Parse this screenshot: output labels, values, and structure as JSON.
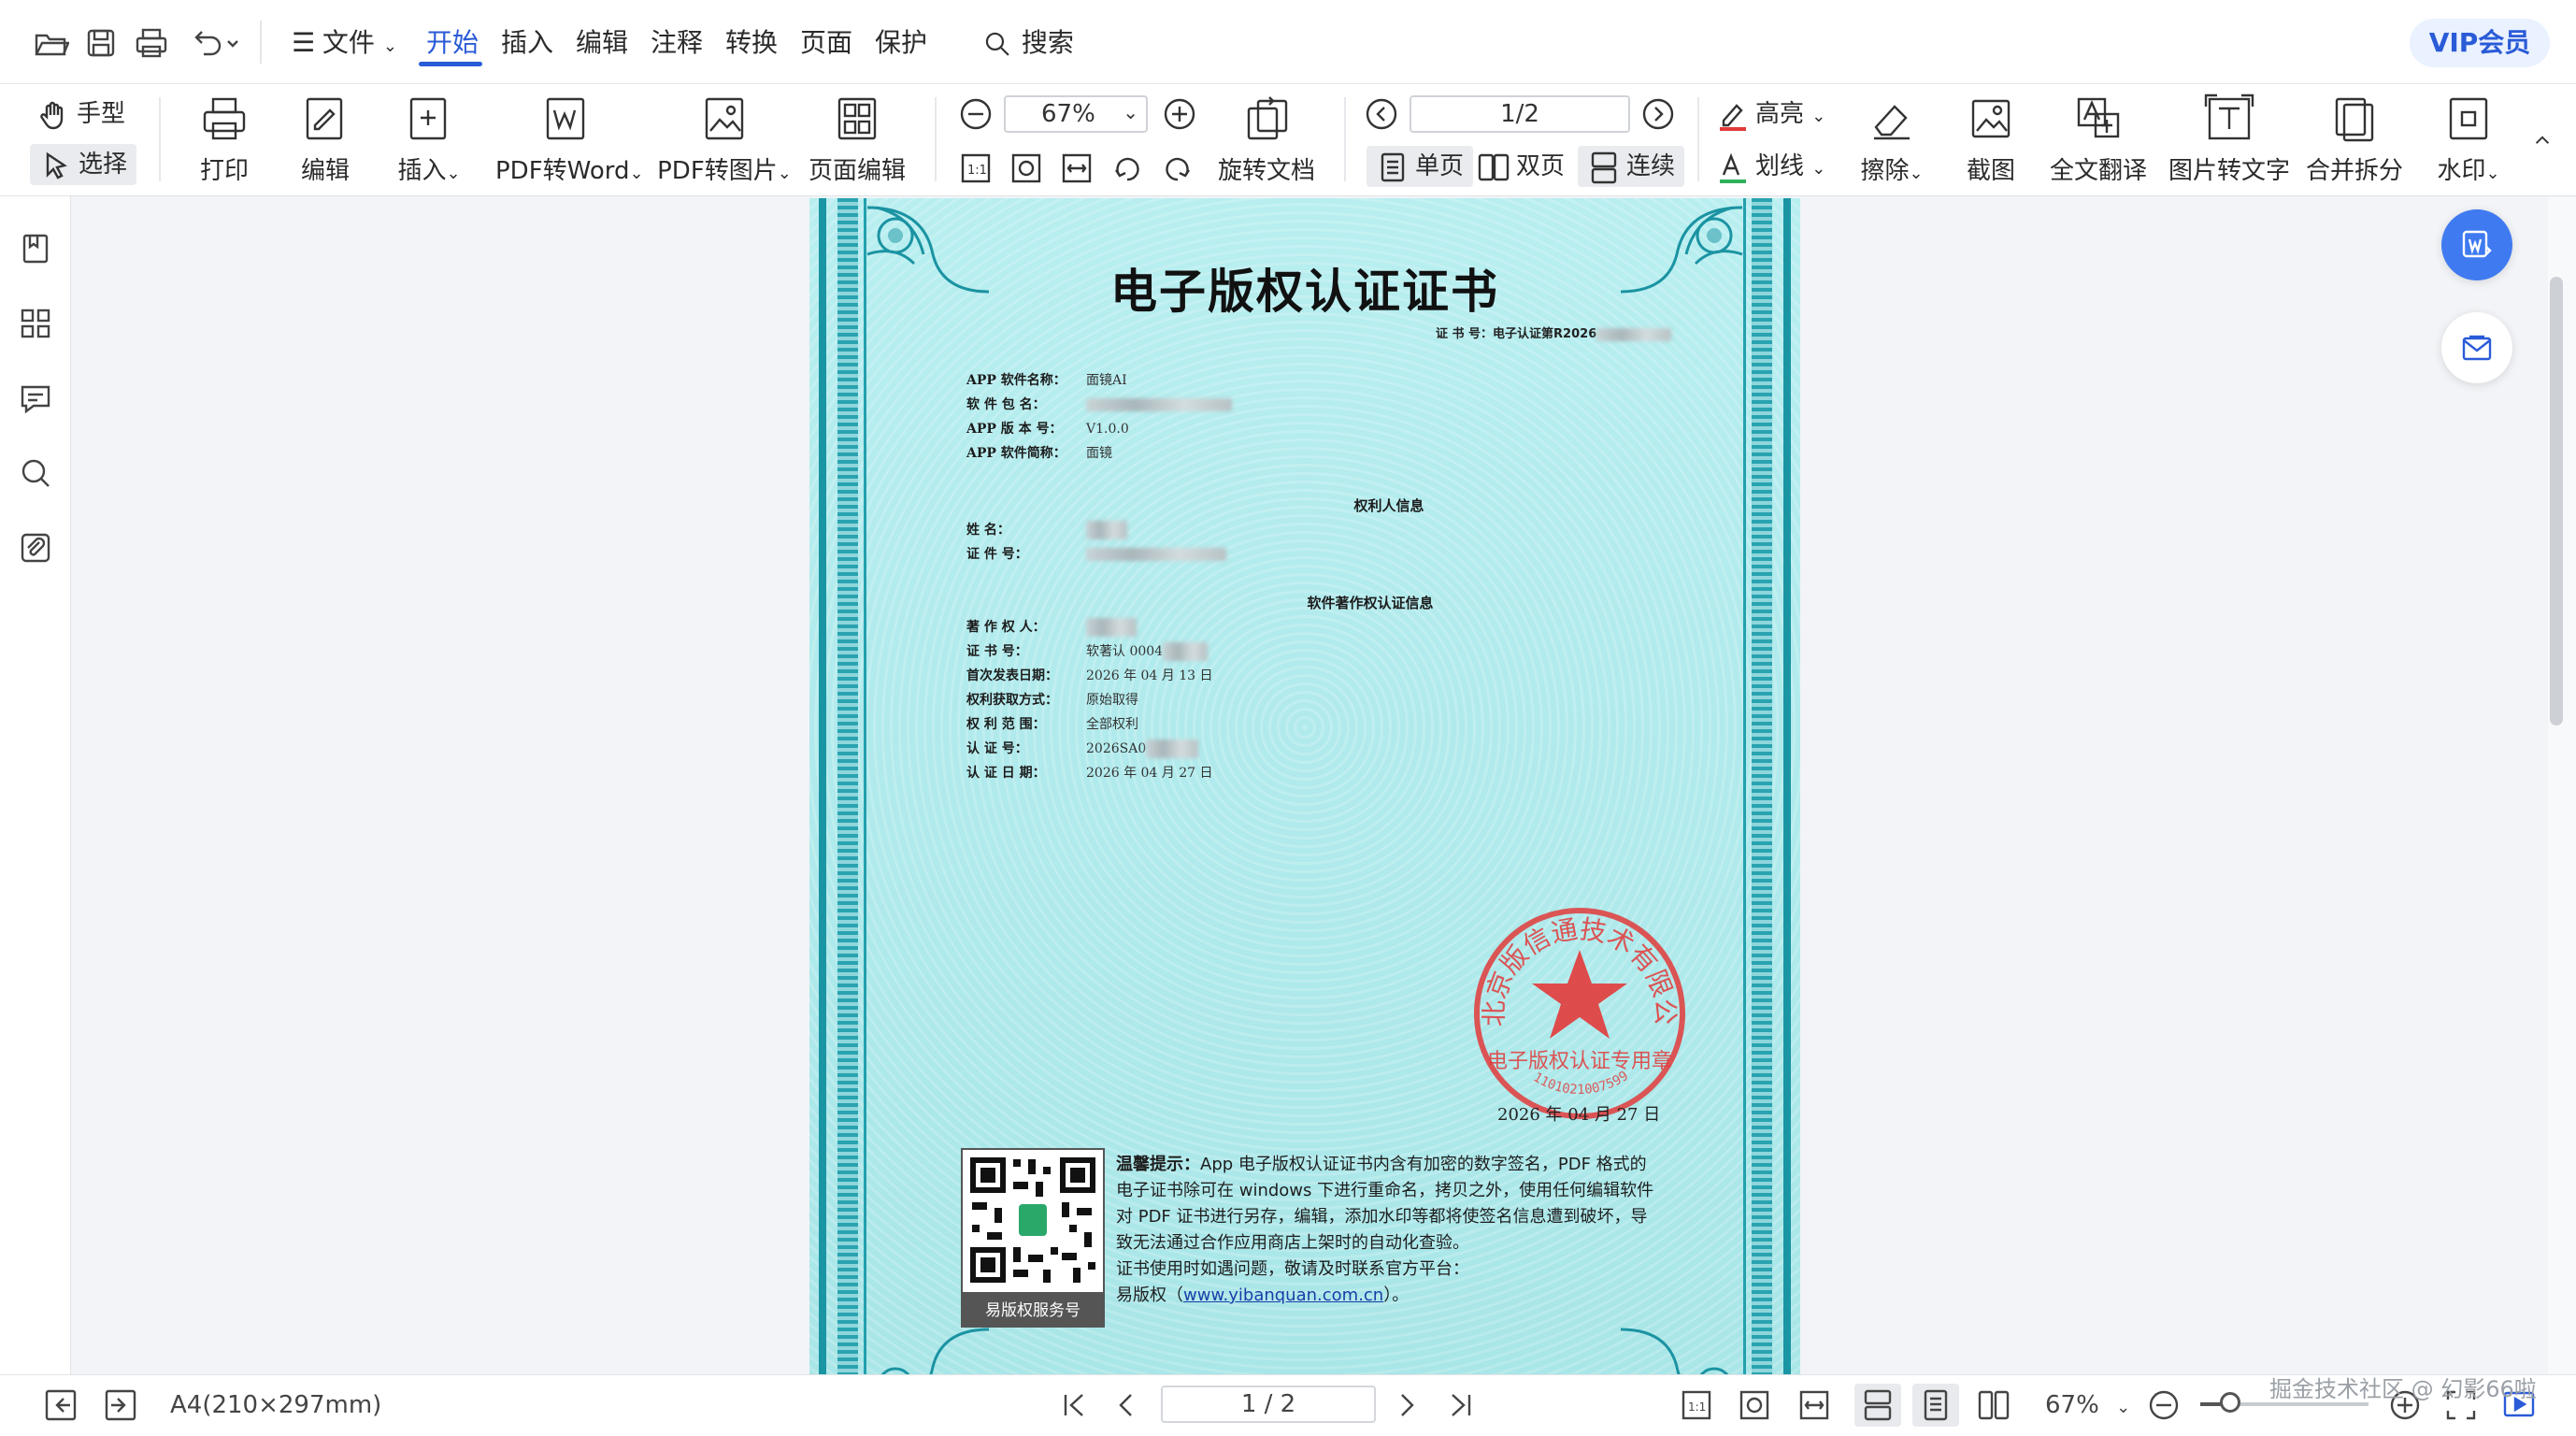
{
  "menubar": {
    "items": [
      "文件",
      "开始",
      "插入",
      "编辑",
      "注释",
      "转换",
      "页面",
      "保护"
    ],
    "file_label": "文件",
    "active_tab": "开始",
    "search_label": "搜索",
    "vip_label": "VIP会员"
  },
  "ribbon": {
    "hand_label": "手型",
    "select_label": "选择",
    "print_label": "打印",
    "edit_label": "编辑",
    "insert_label": "插入",
    "pdf_to_word_label": "PDF转Word",
    "pdf_to_image_label": "PDF转图片",
    "page_edit_label": "页面编辑",
    "zoom_value": "67%",
    "rotate_label": "旋转文档",
    "page_indicator": "1/2",
    "single_page_label": "单页",
    "double_page_label": "双页",
    "continuous_label": "连续",
    "highlight_label": "高亮",
    "underline_label": "划线",
    "erase_label": "擦除",
    "screenshot_label": "截图",
    "translate_label": "全文翻译",
    "ocr_label": "图片转文字",
    "merge_split_label": "合并拆分",
    "watermark_label": "水印"
  },
  "certificate": {
    "title": "电子版权认证证书",
    "cert_no_label": "证 书 号：电子认证第R2026",
    "fields_app": [
      {
        "key": "APP 软件名称：",
        "value": "面镜AI"
      },
      {
        "key": "软  件  包  名：",
        "value": ""
      },
      {
        "key": "APP 版 本 号：",
        "value": "V1.0.0"
      },
      {
        "key": "APP 软件简称：",
        "value": "面镜"
      }
    ],
    "rights_holder_heading": "权利人信息",
    "fields_holder": [
      {
        "key": "姓        名：",
        "value": ""
      },
      {
        "key": "证    件    号：",
        "value": ""
      }
    ],
    "software_heading": "软件著作权认证信息",
    "fields_software": [
      {
        "key": "著  作  权  人：",
        "value": ""
      },
      {
        "key": "证    书    号：",
        "value": "软著认 0004"
      },
      {
        "key": "首次发表日期：",
        "value": "2026 年 04 月 13 日"
      },
      {
        "key": "权利获取方式：",
        "value": "原始取得"
      },
      {
        "key": "权  利  范  围：",
        "value": "全部权利"
      },
      {
        "key": "认    证    号：",
        "value": "2026SA0"
      },
      {
        "key": "认  证  日  期：",
        "value": "2026 年 04 月 27 日"
      }
    ],
    "seal_text_top": "北京版信通技术有限公司",
    "seal_text_bottom": "电子版权认证专用章",
    "seal_number": "1101021007599",
    "seal_date": "2026 年 04 月 27 日",
    "qr_caption": "易版权服务号",
    "notice_title": "温馨提示：",
    "notice_body": "App 电子版权认证证书内含有加密的数字签名，PDF 格式的电子证书除可在 windows 下进行重命名，拷贝之外，使用任何编辑软件对 PDF 证书进行另存，编辑，添加水印等都将使签名信息遭到破坏，导致无法通过合作应用商店上架时的自动化查验。",
    "notice_contact": "证书使用时如遇问题，敬请及时联系官方平台：",
    "notice_site_prefix": "易版权（",
    "notice_link": "www.yibanquan.com.cn",
    "notice_site_suffix": "）。"
  },
  "statusbar": {
    "page_size": "A4(210×297mm)",
    "page_indicator": "1 / 2",
    "zoom_value": "67%",
    "zoom_fraction": 0.18
  },
  "watermark_text": "掘金技术社区 @ 幻影66啦",
  "colors": {
    "accent": "#2a5bd7",
    "cert_bg": "#aee9ea",
    "border_teal": "#1a95a3",
    "seal_red": "#e23a3a"
  }
}
